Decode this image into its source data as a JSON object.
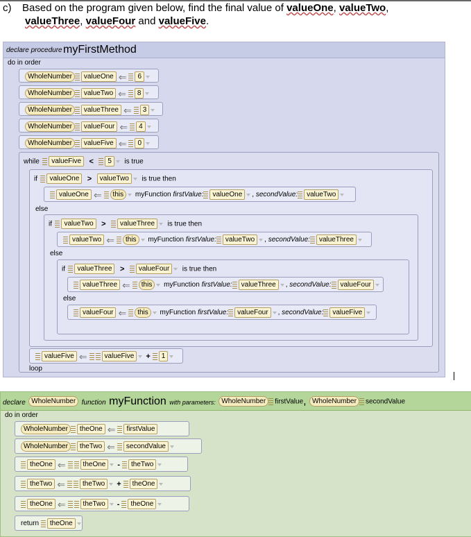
{
  "question": {
    "label": "c)",
    "text_before": "Based on the program given below, find the final value of",
    "vars": [
      "valueOne",
      "valueTwo",
      "valueThree",
      "valueFour",
      "valueFive"
    ],
    "sep1": ",",
    "sep2": ",",
    "sep3": ",",
    "and": "and",
    "end": "."
  },
  "method1": {
    "declare": "declare procedure",
    "name": "myFirstMethod",
    "do_in_order": "do in order",
    "decls": [
      {
        "type": "WholeNumber",
        "var": "valueOne",
        "value": "6"
      },
      {
        "type": "WholeNumber",
        "var": "valueTwo",
        "value": "8"
      },
      {
        "type": "WholeNumber",
        "var": "valueThree",
        "value": "3"
      },
      {
        "type": "WholeNumber",
        "var": "valueFour",
        "value": "4"
      },
      {
        "type": "WholeNumber",
        "var": "valueFive",
        "value": "0"
      }
    ],
    "while_kw": "while",
    "while_var": "valueFive",
    "while_op": "<",
    "while_val": "5",
    "is_true": "is true",
    "if_kw": "if",
    "is_true_then": "is true then",
    "else_kw": "else",
    "gt": ">",
    "this_kw": "this",
    "fn_name": "myFunction",
    "first_param": "firstValue:",
    "second_param": "secondValue:",
    "if1": {
      "a": "valueOne",
      "b": "valueTwo",
      "target": "valueOne",
      "arg1": "valueOne",
      "arg2": "valueTwo"
    },
    "if2": {
      "a": "valueTwo",
      "b": "valueThree",
      "target": "valueTwo",
      "arg1": "valueTwo",
      "arg2": "valueThree"
    },
    "if3": {
      "a": "valueThree",
      "b": "valueFour",
      "target": "valueThree",
      "arg1": "valueThree",
      "arg2": "valueFour"
    },
    "else3": {
      "target": "valueFour",
      "arg1": "valueFour",
      "arg2": "valueFive"
    },
    "incr": {
      "target": "valueFive",
      "var": "valueFive",
      "op": "+",
      "value": "1"
    },
    "loop_kw": "loop"
  },
  "method2": {
    "declare": "declare",
    "ret_type": "WholeNumber",
    "function_kw": "function",
    "name": "myFunction",
    "with_params": "with parameters:",
    "p1_type": "WholeNumber",
    "p1_name": "firstValue",
    "p2_type": "WholeNumber",
    "p2_name": "secondValue",
    "do_in_order": "do in order",
    "d1": {
      "type": "WholeNumber",
      "var": "theOne",
      "value": "firstValue"
    },
    "d2": {
      "type": "WholeNumber",
      "var": "theTwo",
      "value": "secondValue"
    },
    "s1": {
      "target": "theOne",
      "a": "theOne",
      "op": "-",
      "b": "theTwo"
    },
    "s2": {
      "target": "theTwo",
      "a": "theTwo",
      "op": "+",
      "b": "theOne"
    },
    "s3": {
      "target": "theOne",
      "a": "theTwo",
      "op": "-",
      "b": "theOne"
    },
    "return_kw": "return",
    "return_var": "theOne"
  }
}
